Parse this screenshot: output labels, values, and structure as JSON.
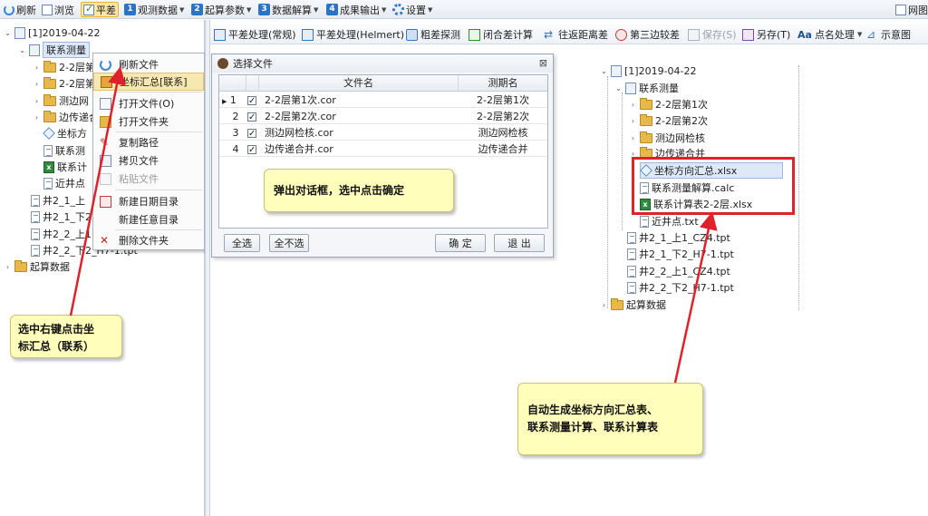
{
  "top_toolbar": {
    "refresh": "刷新",
    "browse": "浏览",
    "adjust": "平差",
    "observe": "观测数据",
    "params": "起算参数",
    "solve": "数据解算",
    "output": "成果输出",
    "settings": "设置",
    "right_item": "网图",
    "num1": "1",
    "num2": "2",
    "num3": "3",
    "num4": "4"
  },
  "left_tree": {
    "date_node": "[1]2019-04-22",
    "link_survey": "联系测量",
    "folders": [
      "2-2层第",
      "2-2层第",
      "测边网",
      "边传递合"
    ],
    "files_partial": [
      "坐标方",
      "联系测",
      "联系计",
      "近井点"
    ],
    "tpt_items": [
      "井2_1_上",
      "井2_1_下2",
      "井2_2_上1",
      "井2_2_下2_H7-1.tpt"
    ],
    "root_data": "起算数据"
  },
  "context_menu": {
    "items": [
      "刷新文件",
      "坐标汇总[联系]",
      "打开文件(O)",
      "打开文件夹",
      "复制路径",
      "拷贝文件",
      "粘贴文件",
      "新建日期目录",
      "新建任意目录",
      "删除文件夹"
    ]
  },
  "main_toolbar": {
    "items": [
      "平差处理(常规)",
      "平差处理(Helmert)",
      "粗差探测",
      "闭合差计算",
      "往返距离差",
      "第三边较差",
      "保存(S)",
      "另存(T)",
      "点名处理",
      "示意图"
    ],
    "aa": "Aa"
  },
  "dialog": {
    "title": "选择文件",
    "close": "⊠",
    "columns": [
      "文件名",
      "测期名"
    ],
    "rows": [
      {
        "idx": "1",
        "file": "2-2层第1次.cor",
        "period": "2-2层第1次"
      },
      {
        "idx": "2",
        "file": "2-2层第2次.cor",
        "period": "2-2层第2次"
      },
      {
        "idx": "3",
        "file": "测边网检核.cor",
        "period": "测边网检核"
      },
      {
        "idx": "4",
        "file": "边传递合并.cor",
        "period": "边传递合并"
      }
    ],
    "btn_all": "全选",
    "btn_none": "全不选",
    "btn_ok": "确 定",
    "btn_exit": "退 出"
  },
  "right_tree": {
    "date_node": "[1]2019-04-22",
    "link_survey": "联系测量",
    "folders": [
      "2-2层第1次",
      "2-2层第2次",
      "测边网检核",
      "边传递合并"
    ],
    "generated": [
      "坐标方向汇总.xlsx",
      "联系测量解算.calc",
      "联系计算表2-2层.xlsx"
    ],
    "others": [
      "近井点.txt",
      "井2_1_上1_CZ4.tpt",
      "井2_1_下2_H7-1.tpt",
      "井2_2_上1_CZ4.tpt",
      "井2_2_下2_H7-1.tpt"
    ],
    "root_data": "起算数据"
  },
  "callouts": {
    "left": "选中右键点击坐\n标汇总（联系）",
    "middle": "弹出对话框，选中点击确定",
    "right": "自动生成坐标方向汇总表、\n联系测量计算、联系计算表"
  },
  "colors": {
    "accent": "#2c72c7",
    "highlight_box": "#e0202a",
    "callout_bg": "#fffebb",
    "arrow": "#e0202a"
  }
}
